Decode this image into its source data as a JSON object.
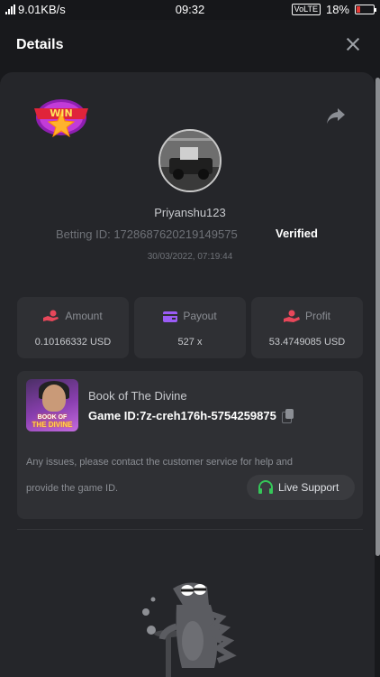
{
  "status_bar": {
    "network_speed": "9.01KB/s",
    "time": "09:32",
    "volte": "VoLTE",
    "battery": "18%",
    "battery_color": "#e53935"
  },
  "header": {
    "title": "Details"
  },
  "badge": {
    "label": "WIN"
  },
  "user": {
    "username": "Priyanshu123",
    "betting_id_label": "Betting ID:",
    "betting_id": "1728687620219149575",
    "verified": "Verified",
    "datetime": "30/03/2022, 07:19:44"
  },
  "stats": [
    {
      "label": "Amount",
      "value": "0.10166332 USD",
      "icon": "coins-hand-icon",
      "icon_color": "#e8475a"
    },
    {
      "label": "Payout",
      "value": "527 x",
      "icon": "wallet-icon",
      "icon_color": "#9b5cf6"
    },
    {
      "label": "Profit",
      "value": "53.4749085 USD",
      "icon": "profit-icon",
      "icon_color": "#e8475a"
    }
  ],
  "game": {
    "name": "Book of The Divine",
    "id_label": "Game ID:",
    "id": "7z-creh176h-5754259875",
    "thumb_line1": "BOOK OF",
    "thumb_line2": "THE DIVINE"
  },
  "support": {
    "help_line1": "Any issues, please contact the customer service for help and",
    "help_line2": "provide the game ID.",
    "button_label": "Live Support",
    "icon_color": "#35c759"
  }
}
